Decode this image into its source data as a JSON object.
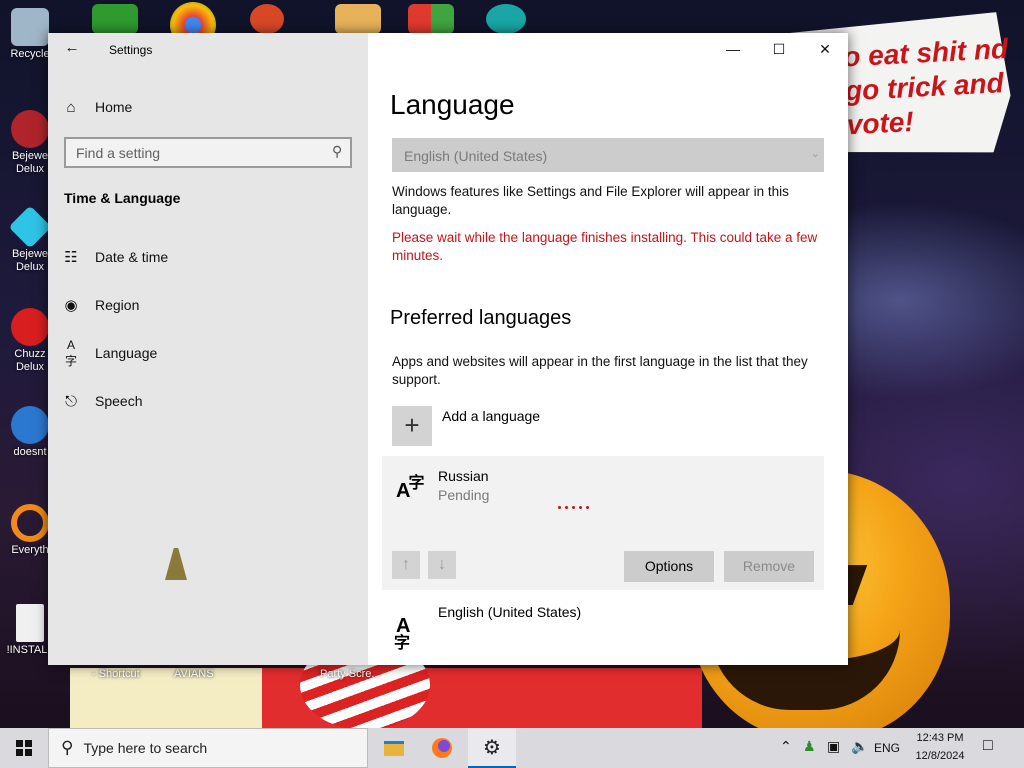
{
  "desktop": {
    "icons": [
      {
        "label": "Recycle"
      },
      {
        "label": "Bejewe Delux"
      },
      {
        "label": "Bejewe Delux"
      },
      {
        "label": "Chuzz Delux"
      },
      {
        "label": "doesnt"
      },
      {
        "label": "Everyth"
      },
      {
        "label": "!INSTALL"
      }
    ],
    "poster_text": "o eat shit nd go trick and vote!",
    "shortcut_labels": [
      "- Shortcut",
      "AVIANS",
      "Party Scre..."
    ]
  },
  "window": {
    "title": "Settings",
    "nav": {
      "home_label": "Home",
      "search_placeholder": "Find a setting",
      "section_title": "Time & Language",
      "items": [
        {
          "label": "Date & time",
          "icon": "calendar-clock-icon"
        },
        {
          "label": "Region",
          "icon": "globe-icon"
        },
        {
          "label": "Language",
          "icon": "language-icon"
        },
        {
          "label": "Speech",
          "icon": "microphone-icon"
        }
      ]
    },
    "content": {
      "page_title": "Language",
      "display_language_value": "English (United States)",
      "display_language_desc": "Windows features like Settings and File Explorer will appear in this language.",
      "install_warning": "Please wait while the language finishes installing. This could take a few minutes.",
      "preferred_title": "Preferred languages",
      "preferred_desc": "Apps and websites will appear in the first language in the list that they support.",
      "add_language_label": "Add a language",
      "languages": [
        {
          "name": "Russian",
          "status": "Pending"
        },
        {
          "name": "English (United States)",
          "status": ""
        }
      ],
      "options_label": "Options",
      "remove_label": "Remove"
    }
  },
  "taskbar": {
    "search_placeholder": "Type here to search",
    "lang_indicator": "ENG",
    "time": "12:43 PM",
    "date": "12/8/2024",
    "accent_color": "#0067c0"
  }
}
